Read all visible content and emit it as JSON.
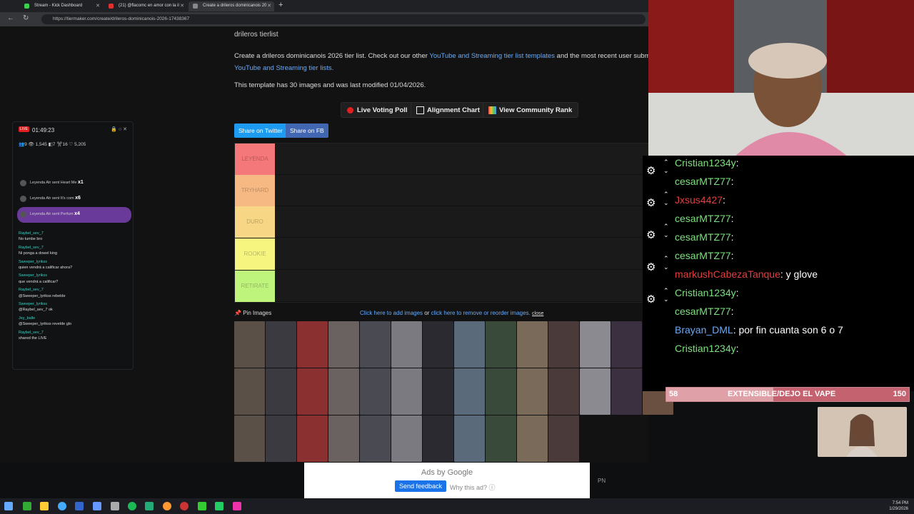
{
  "browser": {
    "tabs": [
      {
        "label": "Stream - Kick Dashboard",
        "color": "#3bd14c"
      },
      {
        "label": "(21) @flacomc en amor con la il",
        "color": "#e03030"
      },
      {
        "label": "Create a drileros dominicanois 20",
        "color": "#444"
      }
    ],
    "new_tab": "+",
    "url": "https://tiermaker.com/create/drileros-dominicanois-2026-17438367"
  },
  "page": {
    "breadcrumb": "drileros tierlist",
    "intro_1": "Create a drileros dominicanois 2026 tier list. Check out our other ",
    "intro_link_1": "YouTube and Streaming tier list templates",
    "intro_2": " and the most recent user subm",
    "intro_link_2": "YouTube and Streaming tier lists.",
    "template_info": "This template has 30 images and was last modified 01/04/2026.",
    "buttons": {
      "live_voting": "Live Voting Poll",
      "alignment": "Alignment Chart",
      "community": "View Community Rank"
    },
    "share": {
      "twitter": "Share on Twitter",
      "fb": "Share on FB"
    },
    "tiers": [
      {
        "label": "LEYENDA",
        "color": "#f4777a"
      },
      {
        "label": "TRYHARD",
        "color": "#f7b983"
      },
      {
        "label": "DURO",
        "color": "#f7d785"
      },
      {
        "label": "ROOKIE",
        "color": "#f5f57f"
      },
      {
        "label": "RETIRATE",
        "color": "#bff47c"
      }
    ],
    "pin_images": "Pin Images",
    "add_images": "Click here to add images",
    "or": " or ",
    "remove_images": "click here to remove or reorder images.",
    "close": "close"
  },
  "ad": {
    "by": "Ads by Google",
    "send_feedback": "Send feedback",
    "why": "Why this ad? ⓘ",
    "pn": "PN"
  },
  "kick": {
    "live": "LIVE",
    "time": "01:49:23",
    "stats": "👥9   👁 1,545   ◧7   ✂16   ♡ 5,205",
    "gifts": [
      {
        "text": "Leyenda Atr sent Heart Me",
        "count": "x1"
      },
      {
        "text": "Leyenda Atr sent It's com",
        "count": "x6"
      },
      {
        "text": "Leyenda Atr sent Perfum",
        "count": "x4"
      }
    ],
    "chat": [
      {
        "user": "Raybel_sev_7",
        "msg": "No tumbe bro"
      },
      {
        "user": "Raybel_sev_7",
        "msg": "Ni ponga a dowel king"
      },
      {
        "user": "Sweeper_lyrikss",
        "msg": "quien vendrá a calificar ahora?"
      },
      {
        "user": "Sweeper_lyrikss",
        "msg": "que vendrá a calificar?"
      },
      {
        "user": "Raybel_sev_7",
        "msg": "@Sweeper_lyrikss rebelde"
      },
      {
        "user": "Sweeper_lyrikss",
        "msg": "@Raybel_sev_7 ok"
      },
      {
        "user": "Jey_balle",
        "msg": "@Sweeper_lyrikss revelde glo"
      },
      {
        "user": "Raybel_sev_7",
        "msg": "shared the LIVE"
      }
    ]
  },
  "overlay_chat": [
    {
      "user": "Cristian1234y",
      "msg": ": ",
      "color": "#7ee07e"
    },
    {
      "user": "cesarMTZ77",
      "msg": ": ",
      "color": "#7ee07e"
    },
    {
      "user": "Jxsus4427",
      "msg": ": ",
      "color": "#e04040"
    },
    {
      "user": "cesarMTZ77",
      "msg": ": ",
      "color": "#7ee07e"
    },
    {
      "user": "cesarMTZ77",
      "msg": ": ",
      "color": "#7ee07e"
    },
    {
      "user": "cesarMTZ77",
      "msg": ": ",
      "color": "#7ee07e"
    },
    {
      "user": "markushCabezaTanque",
      "msg": ": y glove",
      "color": "#e04040"
    },
    {
      "user": "Cristian1234y",
      "msg": ": ",
      "color": "#7ee07e"
    },
    {
      "user": "cesarMTZ77",
      "msg": ": ",
      "color": "#7ee07e"
    },
    {
      "user": "Brayan_DML",
      "msg": ": por fin cuanta son 6 o 7",
      "color": "#6aaaf7"
    },
    {
      "user": "Cristian1234y",
      "msg": ": ",
      "color": "#7ee07e"
    }
  ],
  "goal": {
    "current": "58",
    "label": "EXTENSIBLE/DEJO EL VAPE",
    "target": "150"
  },
  "clock": {
    "time": "7:54 PM",
    "date": "1/29/2026"
  }
}
